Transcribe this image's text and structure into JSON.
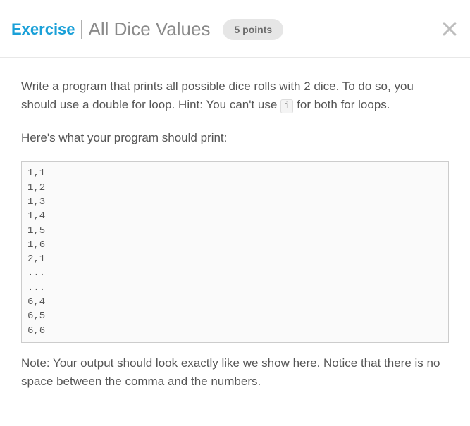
{
  "header": {
    "label": "Exercise",
    "title": "All Dice Values",
    "points": "5 points"
  },
  "content": {
    "intro_pre": "Write a program that prints all possible dice rolls with 2 dice. To do so, you should use a double for loop. Hint: You can't use ",
    "intro_code": "i",
    "intro_post": " for both for loops.",
    "lead": "Here's what your program should print:",
    "code": "1,1\n1,2\n1,3\n1,4\n1,5\n1,6\n2,1\n...\n...\n6,4\n6,5\n6,6",
    "note": "Note: Your output should look exactly like we show here. Notice that there is no space between the comma and the numbers."
  }
}
